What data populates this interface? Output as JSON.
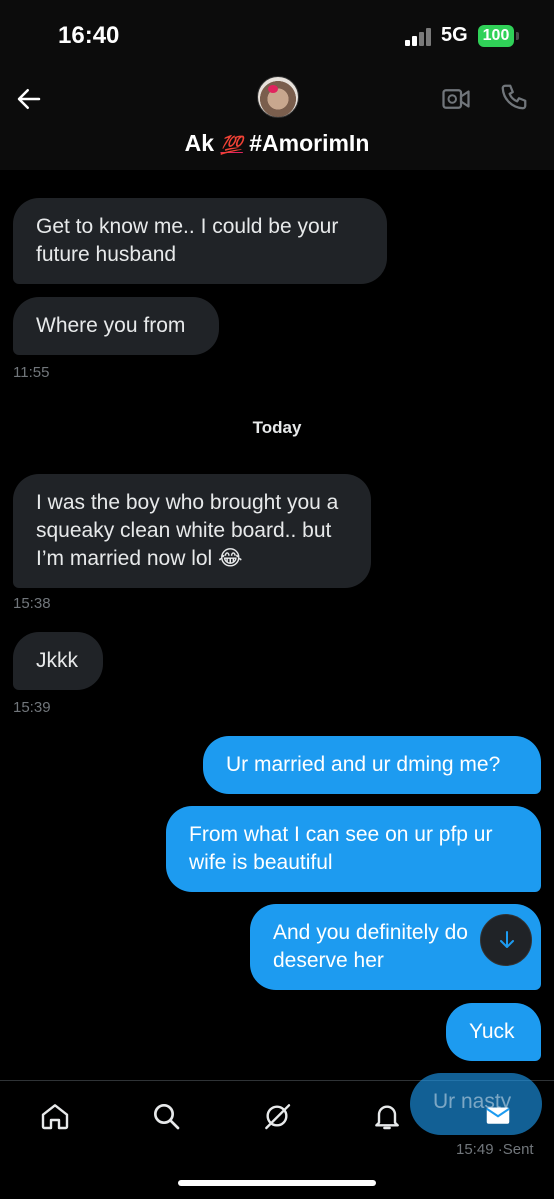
{
  "status_bar": {
    "time": "16:40",
    "network": "5G",
    "battery": "100"
  },
  "header": {
    "name": "Ak",
    "emoji": "💯",
    "handle": "#AmorimIn"
  },
  "messages": [
    {
      "text": "Get to know me.. I could be your future husband",
      "sender": "them"
    },
    {
      "text": "Where you from",
      "sender": "them",
      "time": "11:55"
    },
    {
      "text": "I was the boy who brought you a squeaky clean white board.. but I’m married now lol 😂",
      "sender": "them",
      "time": "15:38"
    },
    {
      "text": "Jkkk",
      "sender": "them",
      "time": "15:39"
    },
    {
      "text": "Ur married and ur dming me?",
      "sender": "me"
    },
    {
      "text": "From what I can see on ur pfp ur wife is beautiful",
      "sender": "me"
    },
    {
      "text": "And you definitely do",
      "sender": "me",
      "continuation": "deserve her"
    },
    {
      "text": "Yuck",
      "sender": "me"
    },
    {
      "text": "Ur nasty",
      "sender": "me",
      "time": "15:49",
      "status": "Sent"
    }
  ],
  "day_separator": "Today",
  "icons": {
    "back": "arrow-left-icon",
    "video": "video-call-icon",
    "call": "phone-icon",
    "scroll": "arrow-down-icon",
    "nav": [
      "home-icon",
      "search-icon",
      "grok-icon",
      "bell-icon",
      "mail-icon"
    ]
  },
  "colors": {
    "accent": "#1d9bf0",
    "incoming": "#202327",
    "battery": "#30d158"
  }
}
